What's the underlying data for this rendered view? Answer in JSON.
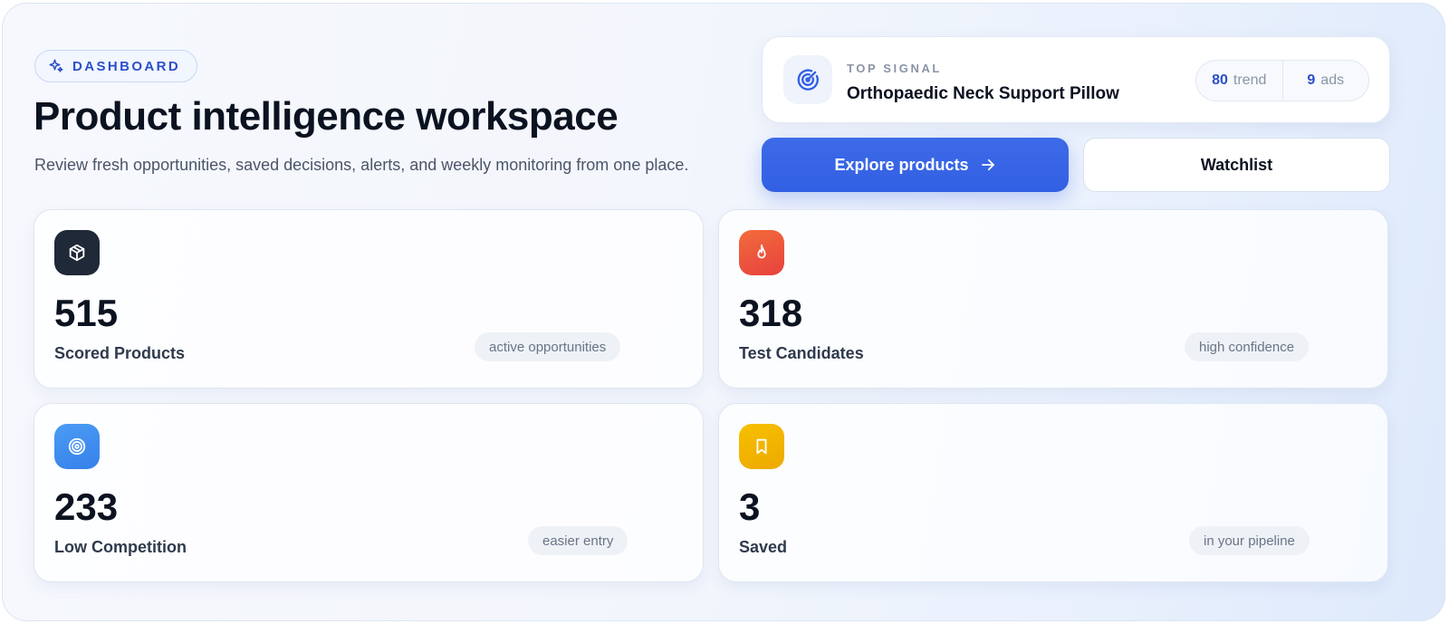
{
  "header": {
    "badge_label": "DASHBOARD",
    "title": "Product intelligence workspace",
    "subtitle": "Review fresh opportunities, saved decisions, alerts, and weekly monitoring from one place."
  },
  "top_signal": {
    "label": "TOP SIGNAL",
    "product_name": "Orthopaedic Neck Support Pillow",
    "trend_value": "80",
    "trend_label": "trend",
    "ads_value": "9",
    "ads_label": "ads",
    "icon": "radar-icon"
  },
  "actions": {
    "explore_label": "Explore products",
    "watchlist_label": "Watchlist"
  },
  "metrics": [
    {
      "value": "515",
      "label": "Scored Products",
      "chip": "active opportunities",
      "icon": "package-icon",
      "color": "#1f2937"
    },
    {
      "value": "318",
      "label": "Test Candidates",
      "chip": "high confidence",
      "icon": "flame-icon",
      "color": "#f0533a"
    },
    {
      "value": "233",
      "label": "Low Competition",
      "chip": "easier entry",
      "icon": "target-icon",
      "color": "#3b8cf0"
    },
    {
      "value": "3",
      "label": "Saved",
      "chip": "in your pipeline",
      "icon": "bookmark-icon",
      "color": "#f2b400"
    }
  ],
  "colors": {
    "accent": "#3260e3",
    "text": "#0b1220",
    "muted": "#8a94a6"
  }
}
